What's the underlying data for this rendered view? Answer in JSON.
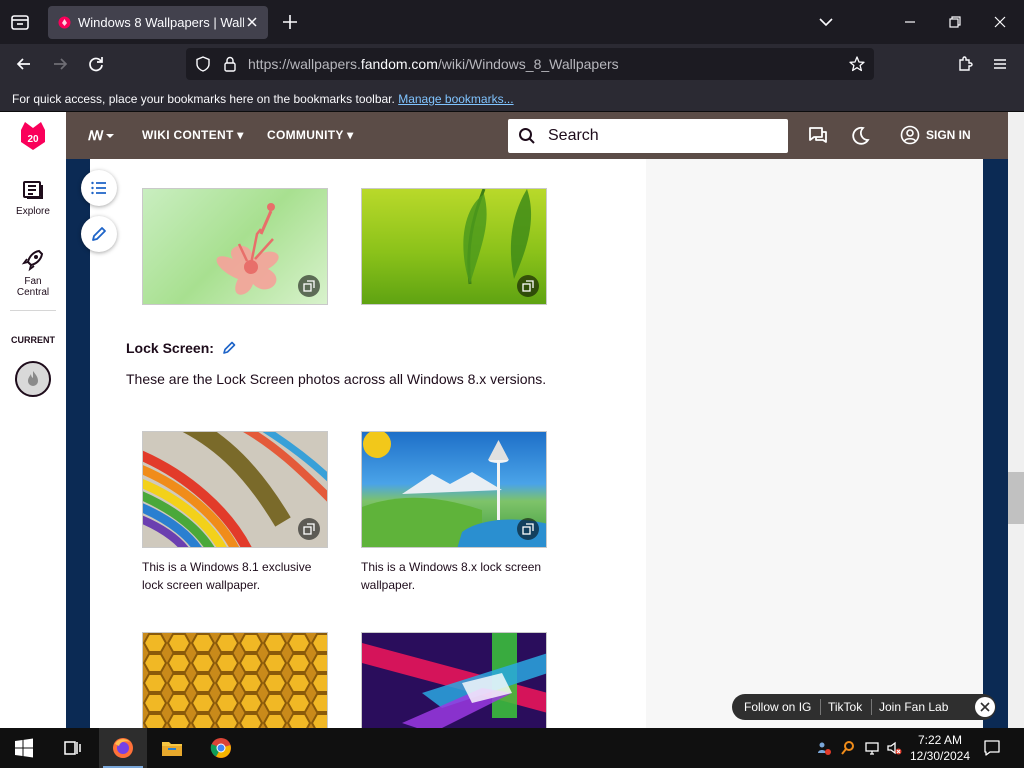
{
  "browser": {
    "tab_title": "Windows 8 Wallpapers | Wallpa",
    "url_prefix": "https://wallpapers.",
    "url_domain": "fandom.com",
    "url_path": "/wiki/Windows_8_Wallpapers",
    "bookmarks_text": "For quick access, place your bookmarks here on the bookmarks toolbar.",
    "bookmarks_link": "Manage bookmarks..."
  },
  "rail": {
    "logo_number": "20",
    "explore": "Explore",
    "fan_central_1": "Fan",
    "fan_central_2": "Central",
    "current": "CURRENT"
  },
  "header": {
    "wiki_content": "WIKI CONTENT",
    "community": "COMMUNITY",
    "search_placeholder": "Search",
    "sign_in": "SIGN IN"
  },
  "article": {
    "section_title": "Lock Screen:",
    "section_text": "These are the Lock Screen photos across all Windows 8.x versions.",
    "captions": [
      "This is a Windows 8.1 exclusive lock screen wallpaper.",
      "This is a Windows 8.x lock screen wallpaper."
    ]
  },
  "social": {
    "follow_ig": "Follow on IG",
    "tiktok": "TikTok",
    "join": "Join Fan Lab"
  },
  "taskbar": {
    "time": "7:22 AM",
    "date": "12/30/2024"
  },
  "colors": {
    "fandom_accent": "#fa005a",
    "wiki_header": "#5b4c47",
    "page_bg": "#0b2a54",
    "link": "#80c4ff"
  }
}
